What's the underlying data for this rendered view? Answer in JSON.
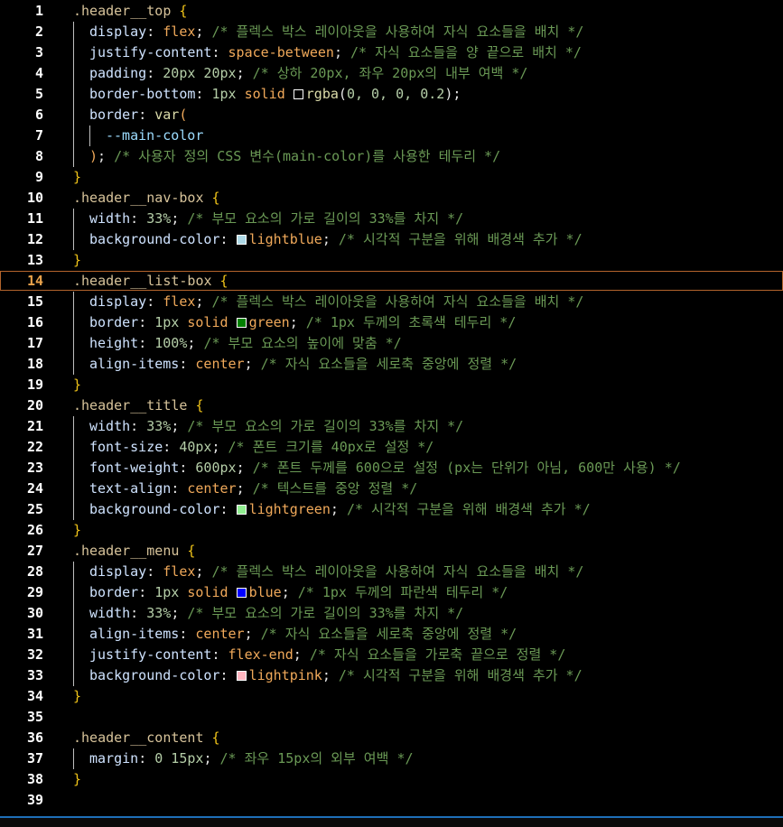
{
  "editor": {
    "current_line": 14,
    "lines": [
      {
        "n": "1",
        "indent": 0,
        "tokens": [
          {
            "t": ".header__top",
            "c": "t-sel"
          },
          {
            "t": " {",
            "c": "t-brace"
          }
        ]
      },
      {
        "n": "2",
        "indent": 1,
        "tokens": [
          {
            "t": "display",
            "c": "t-prop"
          },
          {
            "t": ": ",
            "c": "t-txt"
          },
          {
            "t": "flex",
            "c": "t-kw"
          },
          {
            "t": "; ",
            "c": "t-txt"
          },
          {
            "t": "/* 플렉스 박스 레이아웃을 사용하여 자식 요소들을 배치 */",
            "c": "t-com"
          }
        ]
      },
      {
        "n": "3",
        "indent": 1,
        "tokens": [
          {
            "t": "justify-content",
            "c": "t-prop"
          },
          {
            "t": ": ",
            "c": "t-txt"
          },
          {
            "t": "space-between",
            "c": "t-kw"
          },
          {
            "t": "; ",
            "c": "t-txt"
          },
          {
            "t": "/* 자식 요소들을 양 끝으로 배치 */",
            "c": "t-com"
          }
        ]
      },
      {
        "n": "4",
        "indent": 1,
        "tokens": [
          {
            "t": "padding",
            "c": "t-prop"
          },
          {
            "t": ": ",
            "c": "t-txt"
          },
          {
            "t": "20px 20px",
            "c": "t-num"
          },
          {
            "t": "; ",
            "c": "t-txt"
          },
          {
            "t": "/* 상하 20px, 좌우 20px의 내부 여백 */",
            "c": "t-com"
          }
        ]
      },
      {
        "n": "5",
        "indent": 1,
        "tokens": [
          {
            "t": "border-bottom",
            "c": "t-prop"
          },
          {
            "t": ": ",
            "c": "t-txt"
          },
          {
            "t": "1px",
            "c": "t-num"
          },
          {
            "t": " ",
            "c": "t-txt"
          },
          {
            "t": "solid",
            "c": "t-kw"
          },
          {
            "t": " ",
            "c": "t-txt"
          },
          {
            "swatch": "#000000"
          },
          {
            "t": "rgba",
            "c": "t-fn"
          },
          {
            "t": "(",
            "c": "t-txt"
          },
          {
            "t": "0, 0, 0, 0.2",
            "c": "t-num"
          },
          {
            "t": ");",
            "c": "t-txt"
          }
        ]
      },
      {
        "n": "6",
        "indent": 1,
        "tokens": [
          {
            "t": "border",
            "c": "t-prop"
          },
          {
            "t": ": ",
            "c": "t-txt"
          },
          {
            "t": "var",
            "c": "t-fn"
          },
          {
            "t": "(",
            "c": "t-kw"
          }
        ]
      },
      {
        "n": "7",
        "indent": 2,
        "tokens": [
          {
            "t": "--main-color",
            "c": "t-var"
          }
        ]
      },
      {
        "n": "8",
        "indent": 1,
        "tokens": [
          {
            "t": ")",
            "c": "t-kw"
          },
          {
            "t": "; ",
            "c": "t-txt"
          },
          {
            "t": "/* 사용자 정의 CSS 변수(main-color)를 사용한 테두리 */",
            "c": "t-com"
          }
        ]
      },
      {
        "n": "9",
        "indent": 0,
        "tokens": [
          {
            "t": "}",
            "c": "t-brace"
          }
        ]
      },
      {
        "n": "10",
        "indent": 0,
        "tokens": [
          {
            "t": ".header__nav-box",
            "c": "t-sel"
          },
          {
            "t": " {",
            "c": "t-brace"
          }
        ]
      },
      {
        "n": "11",
        "indent": 1,
        "tokens": [
          {
            "t": "width",
            "c": "t-prop"
          },
          {
            "t": ": ",
            "c": "t-txt"
          },
          {
            "t": "33%",
            "c": "t-num"
          },
          {
            "t": "; ",
            "c": "t-txt"
          },
          {
            "t": "/* 부모 요소의 가로 길이의 33%를 차지 */",
            "c": "t-com"
          }
        ]
      },
      {
        "n": "12",
        "indent": 1,
        "tokens": [
          {
            "t": "background-color",
            "c": "t-prop"
          },
          {
            "t": ": ",
            "c": "t-txt"
          },
          {
            "swatch": "#add8e6"
          },
          {
            "t": "lightblue",
            "c": "t-kw"
          },
          {
            "t": "; ",
            "c": "t-txt"
          },
          {
            "t": "/* 시각적 구분을 위해 배경색 추가 */",
            "c": "t-com"
          }
        ]
      },
      {
        "n": "13",
        "indent": 0,
        "tokens": [
          {
            "t": "}",
            "c": "t-brace"
          }
        ]
      },
      {
        "n": "14",
        "indent": 0,
        "tokens": [
          {
            "t": ".header__list-box",
            "c": "t-sel"
          },
          {
            "t": " {",
            "c": "t-brace"
          }
        ]
      },
      {
        "n": "15",
        "indent": 1,
        "tokens": [
          {
            "t": "display",
            "c": "t-prop"
          },
          {
            "t": ": ",
            "c": "t-txt"
          },
          {
            "t": "flex",
            "c": "t-kw"
          },
          {
            "t": "; ",
            "c": "t-txt"
          },
          {
            "t": "/* 플렉스 박스 레이아웃을 사용하여 자식 요소들을 배치 */",
            "c": "t-com"
          }
        ]
      },
      {
        "n": "16",
        "indent": 1,
        "tokens": [
          {
            "t": "border",
            "c": "t-prop"
          },
          {
            "t": ": ",
            "c": "t-txt"
          },
          {
            "t": "1px",
            "c": "t-num"
          },
          {
            "t": " ",
            "c": "t-txt"
          },
          {
            "t": "solid",
            "c": "t-kw"
          },
          {
            "t": " ",
            "c": "t-txt"
          },
          {
            "swatch": "#008000"
          },
          {
            "t": "green",
            "c": "t-kw"
          },
          {
            "t": "; ",
            "c": "t-txt"
          },
          {
            "t": "/* 1px 두께의 초록색 테두리 */",
            "c": "t-com"
          }
        ]
      },
      {
        "n": "17",
        "indent": 1,
        "tokens": [
          {
            "t": "height",
            "c": "t-prop"
          },
          {
            "t": ": ",
            "c": "t-txt"
          },
          {
            "t": "100%",
            "c": "t-num"
          },
          {
            "t": "; ",
            "c": "t-txt"
          },
          {
            "t": "/* 부모 요소의 높이에 맞춤 */",
            "c": "t-com"
          }
        ]
      },
      {
        "n": "18",
        "indent": 1,
        "tokens": [
          {
            "t": "align-items",
            "c": "t-prop"
          },
          {
            "t": ": ",
            "c": "t-txt"
          },
          {
            "t": "center",
            "c": "t-kw"
          },
          {
            "t": "; ",
            "c": "t-txt"
          },
          {
            "t": "/* 자식 요소들을 세로축 중앙에 정렬 */",
            "c": "t-com"
          }
        ]
      },
      {
        "n": "19",
        "indent": 0,
        "tokens": [
          {
            "t": "}",
            "c": "t-brace"
          }
        ]
      },
      {
        "n": "20",
        "indent": 0,
        "tokens": [
          {
            "t": ".header__title",
            "c": "t-sel"
          },
          {
            "t": " {",
            "c": "t-brace"
          }
        ]
      },
      {
        "n": "21",
        "indent": 1,
        "tokens": [
          {
            "t": "width",
            "c": "t-prop"
          },
          {
            "t": ": ",
            "c": "t-txt"
          },
          {
            "t": "33%",
            "c": "t-num"
          },
          {
            "t": "; ",
            "c": "t-txt"
          },
          {
            "t": "/* 부모 요소의 가로 길이의 33%를 차지 */",
            "c": "t-com"
          }
        ]
      },
      {
        "n": "22",
        "indent": 1,
        "tokens": [
          {
            "t": "font-size",
            "c": "t-prop"
          },
          {
            "t": ": ",
            "c": "t-txt"
          },
          {
            "t": "40px",
            "c": "t-num"
          },
          {
            "t": "; ",
            "c": "t-txt"
          },
          {
            "t": "/* 폰트 크기를 40px로 설정 */",
            "c": "t-com"
          }
        ]
      },
      {
        "n": "23",
        "indent": 1,
        "tokens": [
          {
            "t": "font-weight",
            "c": "t-prop"
          },
          {
            "t": ": ",
            "c": "t-txt"
          },
          {
            "t": "600px",
            "c": "t-num"
          },
          {
            "t": "; ",
            "c": "t-txt"
          },
          {
            "t": "/* 폰트 두께를 600으로 설정 (px는 단위가 아님, 600만 사용) */",
            "c": "t-com"
          }
        ]
      },
      {
        "n": "24",
        "indent": 1,
        "tokens": [
          {
            "t": "text-align",
            "c": "t-prop"
          },
          {
            "t": ": ",
            "c": "t-txt"
          },
          {
            "t": "center",
            "c": "t-kw"
          },
          {
            "t": "; ",
            "c": "t-txt"
          },
          {
            "t": "/* 텍스트를 중앙 정렬 */",
            "c": "t-com"
          }
        ]
      },
      {
        "n": "25",
        "indent": 1,
        "tokens": [
          {
            "t": "background-color",
            "c": "t-prop"
          },
          {
            "t": ": ",
            "c": "t-txt"
          },
          {
            "swatch": "#90ee90"
          },
          {
            "t": "lightgreen",
            "c": "t-kw"
          },
          {
            "t": "; ",
            "c": "t-txt"
          },
          {
            "t": "/* 시각적 구분을 위해 배경색 추가 */",
            "c": "t-com"
          }
        ]
      },
      {
        "n": "26",
        "indent": 0,
        "tokens": [
          {
            "t": "}",
            "c": "t-brace"
          }
        ]
      },
      {
        "n": "27",
        "indent": 0,
        "tokens": [
          {
            "t": ".header__menu",
            "c": "t-sel"
          },
          {
            "t": " {",
            "c": "t-brace"
          }
        ]
      },
      {
        "n": "28",
        "indent": 1,
        "tokens": [
          {
            "t": "display",
            "c": "t-prop"
          },
          {
            "t": ": ",
            "c": "t-txt"
          },
          {
            "t": "flex",
            "c": "t-kw"
          },
          {
            "t": "; ",
            "c": "t-txt"
          },
          {
            "t": "/* 플렉스 박스 레이아웃을 사용하여 자식 요소들을 배치 */",
            "c": "t-com"
          }
        ]
      },
      {
        "n": "29",
        "indent": 1,
        "tokens": [
          {
            "t": "border",
            "c": "t-prop"
          },
          {
            "t": ": ",
            "c": "t-txt"
          },
          {
            "t": "1px",
            "c": "t-num"
          },
          {
            "t": " ",
            "c": "t-txt"
          },
          {
            "t": "solid",
            "c": "t-kw"
          },
          {
            "t": " ",
            "c": "t-txt"
          },
          {
            "swatch": "#0000ff"
          },
          {
            "t": "blue",
            "c": "t-kw"
          },
          {
            "t": "; ",
            "c": "t-txt"
          },
          {
            "t": "/* 1px 두께의 파란색 테두리 */",
            "c": "t-com"
          }
        ]
      },
      {
        "n": "30",
        "indent": 1,
        "tokens": [
          {
            "t": "width",
            "c": "t-prop"
          },
          {
            "t": ": ",
            "c": "t-txt"
          },
          {
            "t": "33%",
            "c": "t-num"
          },
          {
            "t": "; ",
            "c": "t-txt"
          },
          {
            "t": "/* 부모 요소의 가로 길이의 33%를 차지 */",
            "c": "t-com"
          }
        ]
      },
      {
        "n": "31",
        "indent": 1,
        "tokens": [
          {
            "t": "align-items",
            "c": "t-prop"
          },
          {
            "t": ": ",
            "c": "t-txt"
          },
          {
            "t": "center",
            "c": "t-kw"
          },
          {
            "t": "; ",
            "c": "t-txt"
          },
          {
            "t": "/* 자식 요소들을 세로축 중앙에 정렬 */",
            "c": "t-com"
          }
        ]
      },
      {
        "n": "32",
        "indent": 1,
        "tokens": [
          {
            "t": "justify-content",
            "c": "t-prop"
          },
          {
            "t": ": ",
            "c": "t-txt"
          },
          {
            "t": "flex-end",
            "c": "t-kw"
          },
          {
            "t": "; ",
            "c": "t-txt"
          },
          {
            "t": "/* 자식 요소들을 가로축 끝으로 정렬 */",
            "c": "t-com"
          }
        ]
      },
      {
        "n": "33",
        "indent": 1,
        "tokens": [
          {
            "t": "background-color",
            "c": "t-prop"
          },
          {
            "t": ": ",
            "c": "t-txt"
          },
          {
            "swatch": "#ffb6c1"
          },
          {
            "t": "lightpink",
            "c": "t-kw"
          },
          {
            "t": "; ",
            "c": "t-txt"
          },
          {
            "t": "/* 시각적 구분을 위해 배경색 추가 */",
            "c": "t-com"
          }
        ]
      },
      {
        "n": "34",
        "indent": 0,
        "tokens": [
          {
            "t": "}",
            "c": "t-brace"
          }
        ]
      },
      {
        "n": "35",
        "indent": 0,
        "tokens": []
      },
      {
        "n": "36",
        "indent": 0,
        "tokens": [
          {
            "t": ".header__content",
            "c": "t-sel"
          },
          {
            "t": " {",
            "c": "t-brace"
          }
        ]
      },
      {
        "n": "37",
        "indent": 1,
        "tokens": [
          {
            "t": "margin",
            "c": "t-prop"
          },
          {
            "t": ": ",
            "c": "t-txt"
          },
          {
            "t": "0 15px",
            "c": "t-num"
          },
          {
            "t": "; ",
            "c": "t-txt"
          },
          {
            "t": "/* 좌우 15px의 외부 여백 */",
            "c": "t-com"
          }
        ]
      },
      {
        "n": "38",
        "indent": 0,
        "tokens": [
          {
            "t": "}",
            "c": "t-brace"
          }
        ]
      },
      {
        "n": "39",
        "indent": 0,
        "tokens": []
      }
    ]
  },
  "colors": {
    "background": "#000000",
    "current_line_border": "#b3642c",
    "status_border": "#1e6fb8"
  }
}
